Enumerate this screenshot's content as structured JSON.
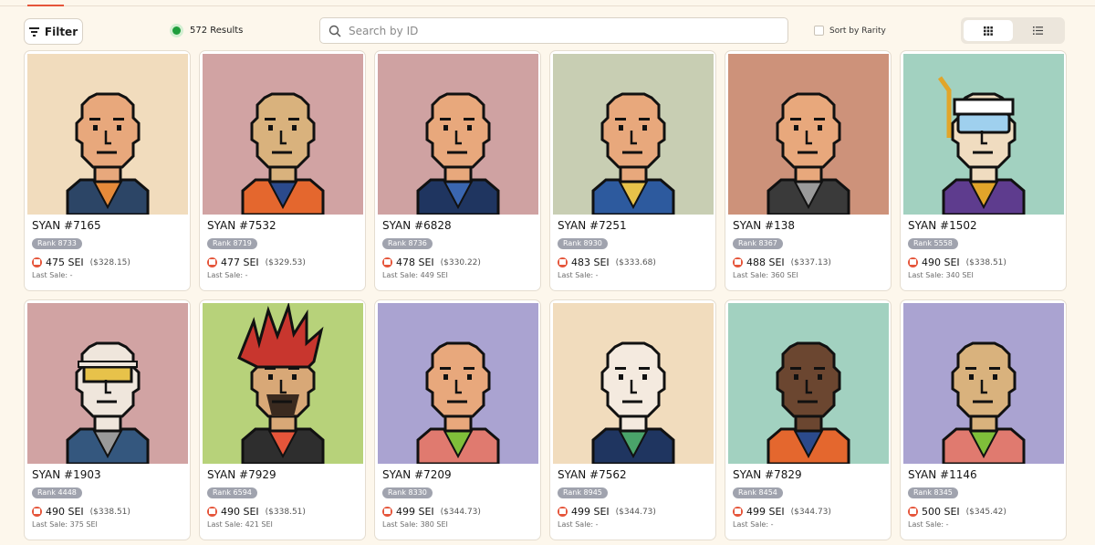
{
  "toolbar": {
    "filter_label": "Filter",
    "results_label": "572 Results",
    "search_placeholder": "Search by ID",
    "sort_label": "Sort by Rarity"
  },
  "colors": {
    "accent": "#e5553a",
    "status_green": "#1f9e3c",
    "rank_badge": "#a0a3ae"
  },
  "cards": [
    {
      "name": "SYAN #7165",
      "rank": "Rank 8733",
      "price": "475 SEI",
      "usd": "($328.15)",
      "last_sale": "Last Sale: -",
      "bg": "#f1dcbd",
      "skin": "#e8a87c",
      "shirt": "#2c4566",
      "accent": "#e58a3a",
      "hair": "none",
      "eyewear": "none"
    },
    {
      "name": "SYAN #7532",
      "rank": "Rank 8719",
      "price": "477 SEI",
      "usd": "($329.53)",
      "last_sale": "Last Sale: -",
      "bg": "#d1a3a3",
      "skin": "#d9b27d",
      "shirt": "#e4672e",
      "accent": "#2b4a8c",
      "hair": "none",
      "eyewear": "none"
    },
    {
      "name": "SYAN #6828",
      "rank": "Rank 8736",
      "price": "478 SEI",
      "usd": "($330.22)",
      "last_sale": "Last Sale: 449 SEI",
      "bg": "#cfa2a2",
      "skin": "#e8a87c",
      "shirt": "#1f3560",
      "accent": "#3a66b0",
      "hair": "none",
      "eyewear": "none"
    },
    {
      "name": "SYAN #7251",
      "rank": "Rank 8930",
      "price": "483 SEI",
      "usd": "($333.68)",
      "last_sale": "Last Sale: -",
      "bg": "#c8ceb3",
      "skin": "#e8a87c",
      "shirt": "#2d5a9e",
      "accent": "#e7c24a",
      "hair": "none",
      "eyewear": "none"
    },
    {
      "name": "SYAN #138",
      "rank": "Rank 8367",
      "price": "488 SEI",
      "usd": "($337.13)",
      "last_sale": "Last Sale: 360 SEI",
      "bg": "#cd927a",
      "skin": "#e8a87c",
      "shirt": "#3a3a3a",
      "accent": "#9a9a9a",
      "hair": "none",
      "eyewear": "none"
    },
    {
      "name": "SYAN #1502",
      "rank": "Rank 5558",
      "price": "490 SEI",
      "usd": "($338.51)",
      "last_sale": "Last Sale: 340 SEI",
      "bg": "#a2d1c0",
      "skin": "#f0dcc0",
      "shirt": "#5e3c8e",
      "accent": "#e1a52a",
      "hair": "none",
      "eyewear": "snorkel"
    },
    {
      "name": "SYAN #1903",
      "rank": "Rank 4448",
      "price": "490 SEI",
      "usd": "($338.51)",
      "last_sale": "Last Sale: 375 SEI",
      "bg": "#d1a3a3",
      "skin": "#efe6dc",
      "shirt": "#34577e",
      "accent": "#9a9a9a",
      "hair": "none",
      "eyewear": "goggles"
    },
    {
      "name": "SYAN #7929",
      "rank": "Rank 6594",
      "price": "490 SEI",
      "usd": "($338.51)",
      "last_sale": "Last Sale: 421 SEI",
      "bg": "#b7d27a",
      "skin": "#d8a877",
      "shirt": "#2e2e2e",
      "accent": "#e5553a",
      "hair": "spiky",
      "eyewear": "none"
    },
    {
      "name": "SYAN #7209",
      "rank": "Rank 8330",
      "price": "499 SEI",
      "usd": "($344.73)",
      "last_sale": "Last Sale: 380 SEI",
      "bg": "#aaa3d1",
      "skin": "#e8a87c",
      "shirt": "#e07a6f",
      "accent": "#7fbf3a",
      "hair": "none",
      "eyewear": "none"
    },
    {
      "name": "SYAN #7562",
      "rank": "Rank 8945",
      "price": "499 SEI",
      "usd": "($344.73)",
      "last_sale": "Last Sale: -",
      "bg": "#f1dcbd",
      "skin": "#f4eadf",
      "shirt": "#1f3560",
      "accent": "#4aa36a",
      "hair": "none",
      "eyewear": "none"
    },
    {
      "name": "SYAN #7829",
      "rank": "Rank 8454",
      "price": "499 SEI",
      "usd": "($344.73)",
      "last_sale": "Last Sale: -",
      "bg": "#a2d1c0",
      "skin": "#6b4630",
      "shirt": "#e4672e",
      "accent": "#2b4a8c",
      "hair": "none",
      "eyewear": "none"
    },
    {
      "name": "SYAN #1146",
      "rank": "Rank 8345",
      "price": "500 SEI",
      "usd": "($345.42)",
      "last_sale": "Last Sale: -",
      "bg": "#aaa3d1",
      "skin": "#d9b27d",
      "shirt": "#e07a6f",
      "accent": "#7fbf3a",
      "hair": "none",
      "eyewear": "none"
    }
  ]
}
